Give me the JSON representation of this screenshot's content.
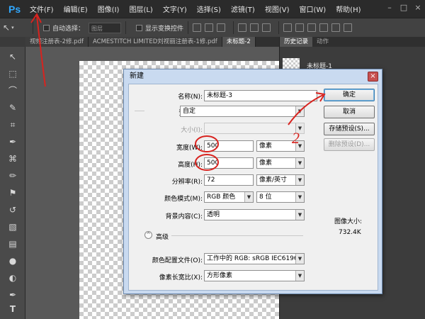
{
  "app": {
    "logo": "Ps",
    "menus": [
      "文件(F)",
      "编辑(E)",
      "图像(I)",
      "图层(L)",
      "文字(Y)",
      "选择(S)",
      "滤镜(T)",
      "视图(V)",
      "窗口(W)",
      "帮助(H)"
    ],
    "window_controls": [
      "–",
      "□",
      "×"
    ]
  },
  "options_bar": {
    "auto_select_label": "自动选择：",
    "auto_select_value": "图层",
    "show_transform_label": "显示变换控件"
  },
  "doc_tabs": [
    "视频注册表-2修.pdf",
    "ACMESTITCH LIMITED刘视丽注册表-1修.pdf",
    "未标题-2"
  ],
  "right_panel": {
    "tabs": [
      "历史记录",
      "动作"
    ],
    "history_item": "未标题-1"
  },
  "dialog": {
    "title": "新建",
    "close": "×",
    "name_label": "名称(N):",
    "name_value": "未标题-3",
    "preset_label": "预设(P):",
    "preset_value": "自定",
    "size_label": "大小(I):",
    "width_label": "宽度(W):",
    "width_value": "500",
    "width_unit": "像素",
    "height_label": "高度(H):",
    "height_value": "500",
    "height_unit": "像素",
    "resolution_label": "分辨率(R):",
    "resolution_value": "72",
    "resolution_unit": "像素/英寸",
    "color_mode_label": "颜色模式(M):",
    "color_mode_value": "RGB 颜色",
    "color_depth_value": "8 位",
    "background_label": "背景内容(C):",
    "background_value": "透明",
    "advanced_label": "高级",
    "advanced_toggle": "^",
    "profile_label": "颜色配置文件(O):",
    "profile_value": "工作中的 RGB: sRGB IEC6196...",
    "aspect_label": "像素长宽比(X):",
    "aspect_value": "方形像素",
    "ok_label": "确定",
    "cancel_label": "取消",
    "save_preset_label": "存储预设(S)...",
    "delete_preset_label": "删除预设(D)...",
    "image_size_label": "图像大小:",
    "image_size_value": "732.4K"
  },
  "annotation": {
    "number": "2",
    "color": "#d8231f"
  }
}
